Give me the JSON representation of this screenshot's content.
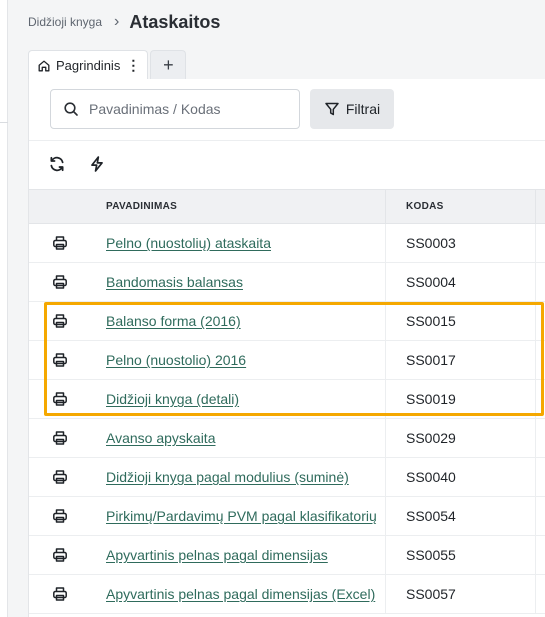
{
  "breadcrumb": {
    "parent": "Didžioji knyga",
    "current": "Ataskaitos"
  },
  "tabs": {
    "active_label": "Pagrindinis",
    "menu_glyph": "⋮",
    "add_glyph": "+"
  },
  "search": {
    "placeholder": "Pavadinimas / Kodas",
    "value": ""
  },
  "filters": {
    "label": "Filtrai"
  },
  "table": {
    "columns": {
      "name": "PAVADINIMAS",
      "code": "KODAS"
    },
    "rows": [
      {
        "name": "Pelno (nuostolių) ataskaita",
        "code": "SS0003"
      },
      {
        "name": "Bandomasis balansas",
        "code": "SS0004"
      },
      {
        "name": "Balanso forma (2016)",
        "code": "SS0015"
      },
      {
        "name": "Pelno (nuostolio) 2016",
        "code": "SS0017"
      },
      {
        "name": "Didžioji knyga (detali)",
        "code": "SS0019"
      },
      {
        "name": "Avanso apyskaita",
        "code": "SS0029"
      },
      {
        "name": "Didžioji knyga pagal modulius (suminė)",
        "code": "SS0040"
      },
      {
        "name": "Pirkimų/Pardavimų PVM pagal klasifikatorių",
        "code": "SS0054"
      },
      {
        "name": "Apyvartinis pelnas pagal dimensijas",
        "code": "SS0055"
      },
      {
        "name": "Apyvartinis pelnas pagal dimensijas (Excel)",
        "code": "SS0057"
      }
    ]
  },
  "colors": {
    "link": "#2f6b5c",
    "highlight": "#f5a800",
    "header_bg": "#f0f1f3"
  },
  "icons": {
    "row_action": "printer-icon",
    "refresh": "refresh-icon",
    "quick": "lightning-icon"
  }
}
